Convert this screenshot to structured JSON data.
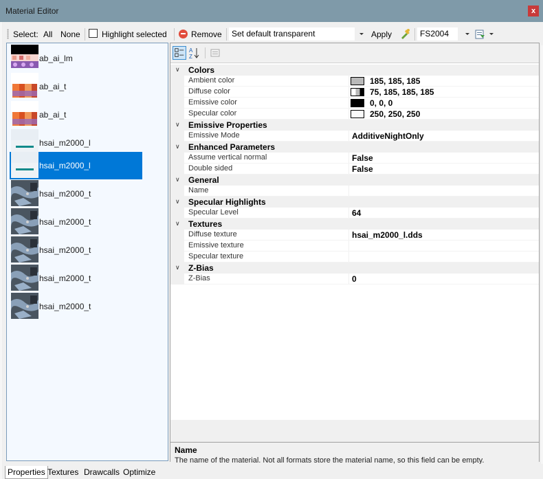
{
  "window": {
    "title": "Material Editor",
    "close_label": "x"
  },
  "toolbar": {
    "select_label": "Select:",
    "all_label": "All",
    "none_label": "None",
    "highlight_label": "Highlight selected",
    "remove_label": "Remove",
    "transparency_combo": "Set default transparent",
    "apply_label": "Apply",
    "format_combo": "FS2004"
  },
  "materials": [
    {
      "label": "ab_ai_lm",
      "thumb": "lm",
      "selected": false
    },
    {
      "label": "ab_ai_t",
      "thumb": "t",
      "selected": false
    },
    {
      "label": "ab_ai_t",
      "thumb": "t",
      "selected": false
    },
    {
      "label": "hsai_m2000_l",
      "thumb": "l",
      "selected": false
    },
    {
      "label": "hsai_m2000_l",
      "thumb": "l",
      "selected": true
    },
    {
      "label": "hsai_m2000_t",
      "thumb": "m",
      "selected": false
    },
    {
      "label": "hsai_m2000_t",
      "thumb": "m",
      "selected": false
    },
    {
      "label": "hsai_m2000_t",
      "thumb": "m",
      "selected": false
    },
    {
      "label": "hsai_m2000_t",
      "thumb": "m",
      "selected": false
    },
    {
      "label": "hsai_m2000_t",
      "thumb": "m",
      "selected": false
    }
  ],
  "property_grid": {
    "categories": [
      {
        "name": "Colors",
        "rows": [
          {
            "name": "Ambient color",
            "value": "185, 185, 185",
            "swatch": "#b9b9b9"
          },
          {
            "name": "Diffuse color",
            "value": "75, 185, 185, 185",
            "swatch": "half"
          },
          {
            "name": "Emissive color",
            "value": "0, 0, 0",
            "swatch": "#000000"
          },
          {
            "name": "Specular color",
            "value": "250, 250, 250",
            "swatch": "#fafafa"
          }
        ]
      },
      {
        "name": "Emissive Properties",
        "rows": [
          {
            "name": "Emissive Mode",
            "value": "AdditiveNightOnly"
          }
        ]
      },
      {
        "name": "Enhanced Parameters",
        "rows": [
          {
            "name": "Assume vertical normal",
            "value": "False"
          },
          {
            "name": "Double sided",
            "value": "False"
          }
        ]
      },
      {
        "name": "General",
        "rows": [
          {
            "name": "Name",
            "value": ""
          }
        ]
      },
      {
        "name": "Specular Highlights",
        "rows": [
          {
            "name": "Specular Level",
            "value": "64"
          }
        ]
      },
      {
        "name": "Textures",
        "rows": [
          {
            "name": "Diffuse texture",
            "value": "hsai_m2000_l.dds"
          },
          {
            "name": "Emissive texture",
            "value": ""
          },
          {
            "name": "Specular texture",
            "value": ""
          }
        ]
      },
      {
        "name": "Z-Bias",
        "rows": [
          {
            "name": "Z-Bias",
            "value": "0"
          }
        ]
      }
    ]
  },
  "description": {
    "title": "Name",
    "text": "The name of the material. Not all formats store the material name, so this field can be empty."
  },
  "tabs": [
    {
      "label": "Properties",
      "active": true
    },
    {
      "label": "Textures",
      "active": false
    },
    {
      "label": "Drawcalls",
      "active": false
    },
    {
      "label": "Optimize",
      "active": false
    }
  ]
}
